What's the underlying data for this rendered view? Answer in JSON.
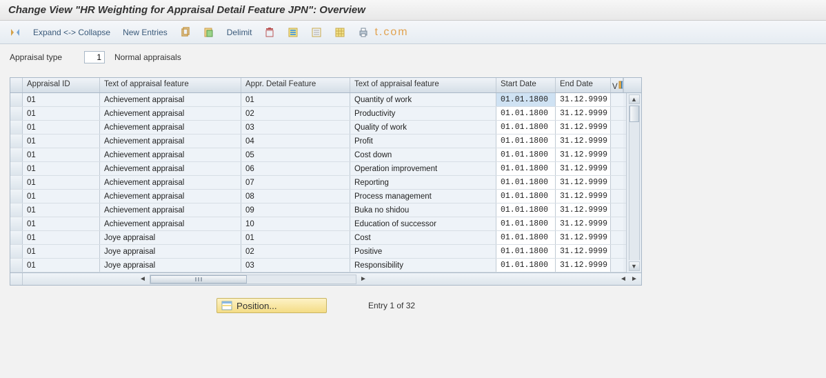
{
  "title": "Change View \"HR Weighting for Appraisal Detail Feature JPN\": Overview",
  "toolbar": {
    "expand_collapse": "Expand <-> Collapse",
    "new_entries": "New Entries",
    "delimit": "Delimit"
  },
  "watermark": "t.com",
  "form": {
    "appraisal_type_label": "Appraisal type",
    "appraisal_type_value": "1",
    "appraisal_type_desc": "Normal appraisals"
  },
  "table": {
    "headers": {
      "id": "Appraisal ID",
      "txt1": "Text of appraisal feature",
      "detail": "Appr. Detail Feature",
      "txt2": "Text of appraisal feature",
      "start": "Start Date",
      "end": "End Date",
      "last": "V"
    },
    "rows": [
      {
        "id": "01",
        "txt1": "Achievement appraisal",
        "detail": "01",
        "txt2": "Quantity of work",
        "start": "01.01.1800",
        "end": "31.12.9999",
        "start_selected": true
      },
      {
        "id": "01",
        "txt1": "Achievement appraisal",
        "detail": "02",
        "txt2": "Productivity",
        "start": "01.01.1800",
        "end": "31.12.9999"
      },
      {
        "id": "01",
        "txt1": "Achievement appraisal",
        "detail": "03",
        "txt2": "Quality of work",
        "start": "01.01.1800",
        "end": "31.12.9999"
      },
      {
        "id": "01",
        "txt1": "Achievement appraisal",
        "detail": "04",
        "txt2": "Profit",
        "start": "01.01.1800",
        "end": "31.12.9999"
      },
      {
        "id": "01",
        "txt1": "Achievement appraisal",
        "detail": "05",
        "txt2": "Cost down",
        "start": "01.01.1800",
        "end": "31.12.9999"
      },
      {
        "id": "01",
        "txt1": "Achievement appraisal",
        "detail": "06",
        "txt2": "Operation improvement",
        "start": "01.01.1800",
        "end": "31.12.9999"
      },
      {
        "id": "01",
        "txt1": "Achievement appraisal",
        "detail": "07",
        "txt2": "Reporting",
        "start": "01.01.1800",
        "end": "31.12.9999"
      },
      {
        "id": "01",
        "txt1": "Achievement appraisal",
        "detail": "08",
        "txt2": "Process management",
        "start": "01.01.1800",
        "end": "31.12.9999"
      },
      {
        "id": "01",
        "txt1": "Achievement appraisal",
        "detail": "09",
        "txt2": "Buka no shidou",
        "start": "01.01.1800",
        "end": "31.12.9999"
      },
      {
        "id": "01",
        "txt1": "Achievement appraisal",
        "detail": "10",
        "txt2": "Education of successor",
        "start": "01.01.1800",
        "end": "31.12.9999"
      },
      {
        "id": "01",
        "txt1": "Joye appraisal",
        "detail": "01",
        "txt2": "Cost",
        "start": "01.01.1800",
        "end": "31.12.9999"
      },
      {
        "id": "01",
        "txt1": "Joye appraisal",
        "detail": "02",
        "txt2": "Positive",
        "start": "01.01.1800",
        "end": "31.12.9999"
      },
      {
        "id": "01",
        "txt1": "Joye appraisal",
        "detail": "03",
        "txt2": "Responsibility",
        "start": "01.01.1800",
        "end": "31.12.9999"
      }
    ]
  },
  "footer": {
    "position_label": "Position...",
    "entry_text": "Entry 1 of 32"
  }
}
